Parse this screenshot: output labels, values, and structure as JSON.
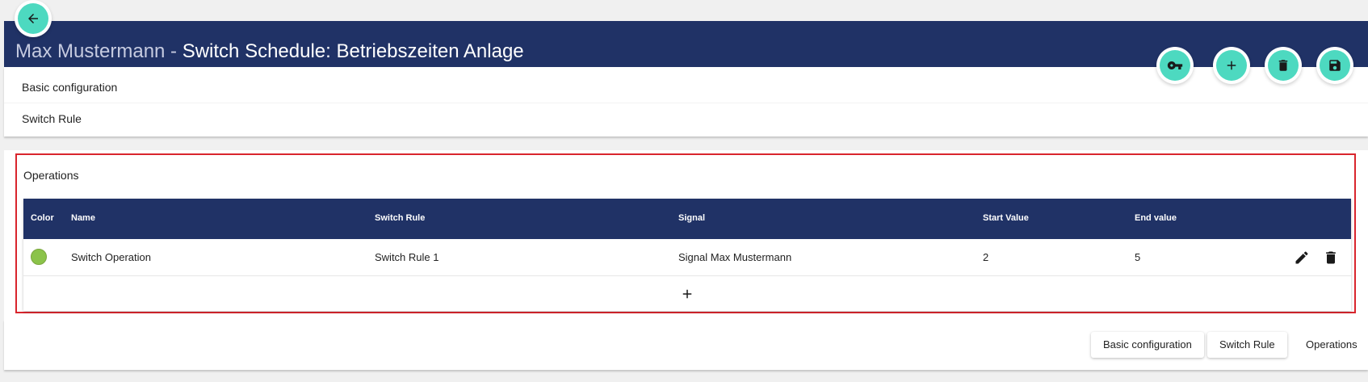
{
  "header": {
    "owner": "Max Mustermann",
    "separator": " - ",
    "title": "Switch Schedule: Betriebszeiten Anlage"
  },
  "icons": {
    "back": "arrow-left-icon",
    "key": "key-icon",
    "add": "plus-icon",
    "delete": "trash-icon",
    "save": "floppy-disk-icon",
    "edit": "pencil-icon",
    "add_row": "plus-icon"
  },
  "config": {
    "basic_configuration": "Basic configuration",
    "switch_rule": "Switch Rule"
  },
  "operations": {
    "title": "Operations",
    "columns": [
      "Color",
      "Name",
      "Switch Rule",
      "Signal",
      "Start Value",
      "End value"
    ],
    "rows": [
      {
        "color": "#8bc34a",
        "name": "Switch Operation",
        "switch_rule": "Switch Rule 1",
        "signal": "Signal Max Mustermann",
        "start_value": "2",
        "end_value": "5"
      }
    ]
  },
  "bottom_tabs": [
    "Basic configuration",
    "Switch Rule",
    "Operations"
  ],
  "active_tab": "Operations",
  "colors": {
    "primary": "#203266",
    "accent": "#4dd9c0",
    "highlight_border": "#d9252d"
  }
}
